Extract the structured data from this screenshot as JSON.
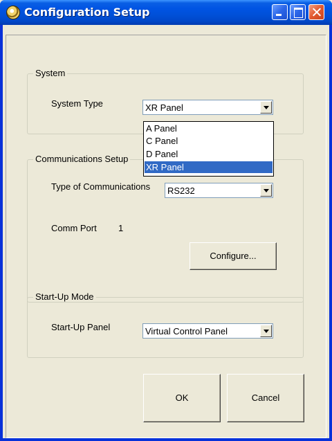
{
  "window": {
    "title": "Configuration Setup"
  },
  "system": {
    "group_title": "System",
    "type_label": "System Type",
    "type_value": "XR Panel",
    "dropdown_options": [
      "A Panel",
      "C Panel",
      "D Panel",
      "XR Panel"
    ],
    "dropdown_selected": "XR Panel"
  },
  "communications": {
    "group_title": "Communications Setup",
    "type_label": "Type of Communications",
    "type_value": "RS232",
    "port_label": "Comm Port",
    "port_value": "1",
    "configure_label": "Configure..."
  },
  "startup": {
    "group_title": "Start-Up Mode",
    "panel_label": "Start-Up Panel",
    "panel_value": "Virtual Control Panel"
  },
  "buttons": {
    "ok_label": "OK",
    "cancel_label": "Cancel"
  },
  "colors": {
    "titlebar": "#0054e3",
    "window_bg": "#ece9d8",
    "selection": "#316ac5",
    "close_button": "#e2592f"
  }
}
